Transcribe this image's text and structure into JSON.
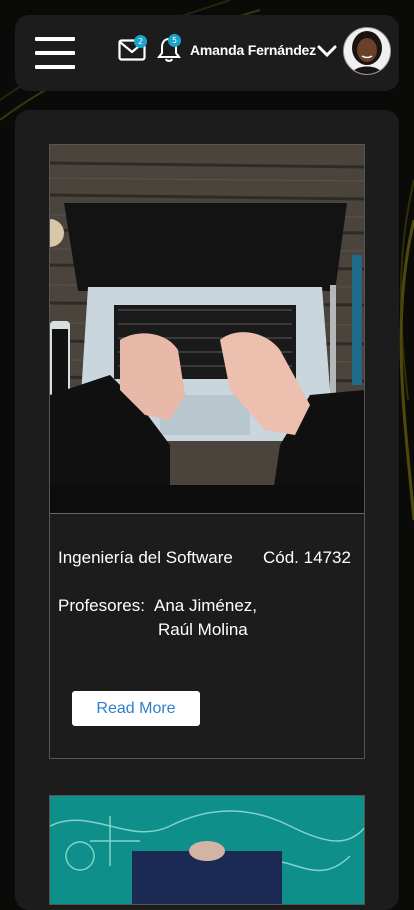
{
  "header": {
    "menu_icon": "hamburger-menu-icon",
    "mail_icon": "mail-icon",
    "mail_count": "2",
    "bell_icon": "bell-icon",
    "notification_count": "5",
    "user_name": "Amanda Fernández",
    "dropdown_icon": "chevron-down-icon"
  },
  "courses": [
    {
      "name": "Ingeniería del Software",
      "code": "Cód. 14732",
      "professors_label": "Profesores:",
      "professor_1": "Ana Jiménez,",
      "professor_2": "Raúl Molina",
      "button_label": "Read More"
    }
  ],
  "colors": {
    "background": "#0a0a08",
    "panel": "#1c1c1c",
    "badge": "#1aa5c8",
    "button_text": "#2f7fd0"
  }
}
